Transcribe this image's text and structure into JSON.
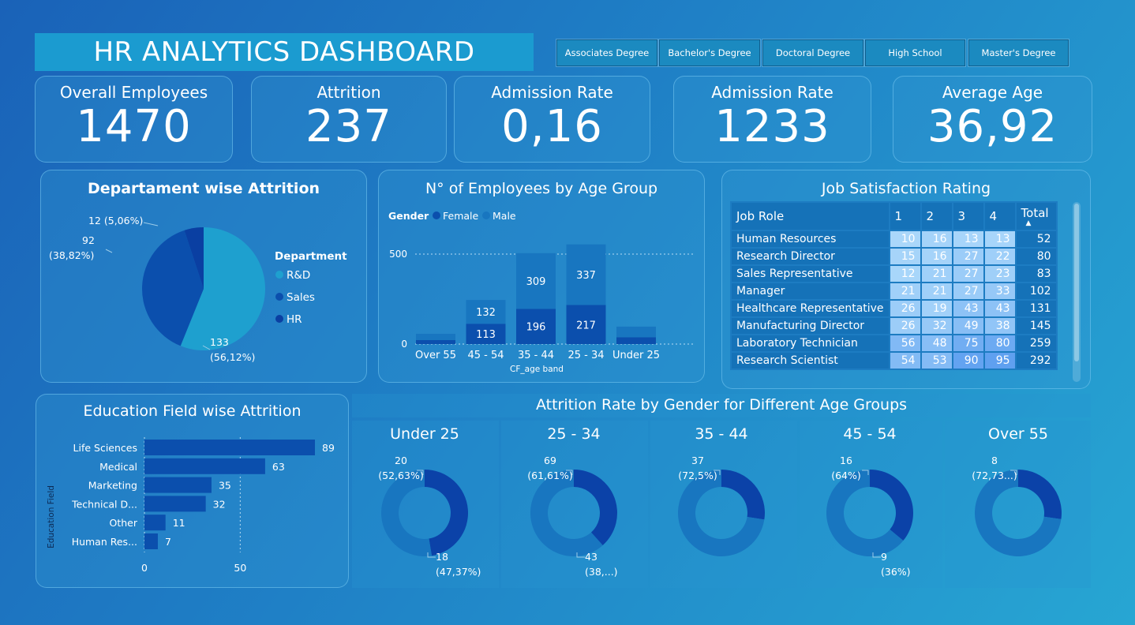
{
  "header": {
    "title": "HR ANALYTICS DASHBOARD"
  },
  "slicers": [
    "Associates Degree",
    "Bachelor's Degree",
    "Doctoral Degree",
    "High School",
    "Master's Degree"
  ],
  "kpis": [
    {
      "label": "Overall Employees",
      "value": "1470"
    },
    {
      "label": "Attrition",
      "value": "237"
    },
    {
      "label": "Admission Rate",
      "value": "0,16"
    },
    {
      "label": "Admission Rate",
      "value": "1233"
    },
    {
      "label": "Average Age",
      "value": "36,92"
    }
  ],
  "dept_attrition": {
    "title": "Departament wise Attrition",
    "legend_title": "Department",
    "legend": [
      "R&D",
      "Sales",
      "HR"
    ],
    "colors": [
      "#1ea0cf",
      "#0b4fad",
      "#0a3fa2"
    ],
    "labels": [
      {
        "value": "133",
        "pct": "(56,12%)"
      },
      {
        "value": "92",
        "pct": "(38,82%)"
      },
      {
        "value": "12 (5,06%)",
        "pct": ""
      }
    ]
  },
  "age_group": {
    "title": "N° of Employees by Age Group",
    "legend_title": "Gender",
    "legend": [
      "Female",
      "Male"
    ],
    "xlabel": "CF_age band",
    "female_color": "#0b4fad",
    "male_color": "#1876c0"
  },
  "job_satisfaction": {
    "title": "Job Satisfaction Rating",
    "headers": [
      "Job Role",
      "1",
      "2",
      "3",
      "4",
      "Total"
    ],
    "rows": [
      {
        "role": "Human Resources",
        "v": [
          "10",
          "16",
          "13",
          "13"
        ],
        "total": "52"
      },
      {
        "role": "Research Director",
        "v": [
          "15",
          "16",
          "27",
          "22"
        ],
        "total": "80"
      },
      {
        "role": "Sales Representative",
        "v": [
          "12",
          "21",
          "27",
          "23"
        ],
        "total": "83"
      },
      {
        "role": "Manager",
        "v": [
          "21",
          "21",
          "27",
          "33"
        ],
        "total": "102"
      },
      {
        "role": "Healthcare Representative",
        "v": [
          "26",
          "19",
          "43",
          "43"
        ],
        "total": "131"
      },
      {
        "role": "Manufacturing Director",
        "v": [
          "26",
          "32",
          "49",
          "38"
        ],
        "total": "145"
      },
      {
        "role": "Laboratory Technician",
        "v": [
          "56",
          "48",
          "75",
          "80"
        ],
        "total": "259"
      },
      {
        "role": "Research Scientist",
        "v": [
          "54",
          "53",
          "90",
          "95"
        ],
        "total": "292"
      }
    ]
  },
  "education": {
    "title": "Education Field wise Attrition",
    "ylabel": "Education Field",
    "bar_color": "#0b4fad"
  },
  "gender_age": {
    "title": "Attrition Rate by Gender for Different Age Groups",
    "groups": [
      {
        "name": "Under 25",
        "male": "20",
        "male_pct": "(52,63%)",
        "female": "18",
        "female_pct": "(47,37%)"
      },
      {
        "name": "25 - 34",
        "male": "69",
        "male_pct": "(61,61%)",
        "female": "43",
        "female_pct": "(38,...)"
      },
      {
        "name": "35 - 44",
        "male": "37",
        "male_pct": "(72,5%)",
        "female": "",
        "female_pct": ""
      },
      {
        "name": "45 - 54",
        "male": "16",
        "male_pct": "(64%)",
        "female": "9",
        "female_pct": "(36%)"
      },
      {
        "name": "Over 55",
        "male": "8",
        "male_pct": "(72,73...)",
        "female": "",
        "female_pct": ""
      }
    ],
    "male_color": "#1876c0",
    "female_color": "#0b42a8"
  },
  "chart_data": [
    {
      "type": "pie",
      "title": "Departament wise Attrition",
      "categories": [
        "R&D",
        "Sales",
        "HR"
      ],
      "values": [
        133,
        92,
        12
      ]
    },
    {
      "type": "bar",
      "title": "N° of Employees by Age Group",
      "xlabel": "CF_age band",
      "categories": [
        "Over 55",
        "45 - 54",
        "35 - 44",
        "25 - 34",
        "Under 25"
      ],
      "series": [
        {
          "name": "Female",
          "values": [
            22,
            113,
            196,
            217,
            38
          ]
        },
        {
          "name": "Male",
          "values": [
            35,
            132,
            309,
            337,
            59
          ]
        }
      ],
      "ylim": [
        0,
        500
      ],
      "yticks": [
        "0",
        "500"
      ],
      "stacked": true
    },
    {
      "type": "bar",
      "orientation": "horizontal",
      "title": "Education Field wise Attrition",
      "ylabel": "Education Field",
      "categories": [
        "Life Sciences",
        "Medical",
        "Marketing",
        "Technical D...",
        "Other",
        "Human Res..."
      ],
      "values": [
        89,
        63,
        35,
        32,
        11,
        7
      ],
      "xlim": [
        0,
        100
      ],
      "xticks": [
        "0",
        "50"
      ]
    },
    {
      "type": "pie",
      "subtype": "donut",
      "title": "Attrition Rate by Gender for Different Age Groups",
      "categories": [
        "Under 25",
        "25 - 34",
        "35 - 44",
        "45 - 54",
        "Over 55"
      ],
      "series": [
        {
          "values": [
            20,
            69,
            37,
            16,
            8
          ]
        },
        {
          "values": [
            18,
            43,
            14,
            9,
            3
          ]
        }
      ]
    }
  ]
}
